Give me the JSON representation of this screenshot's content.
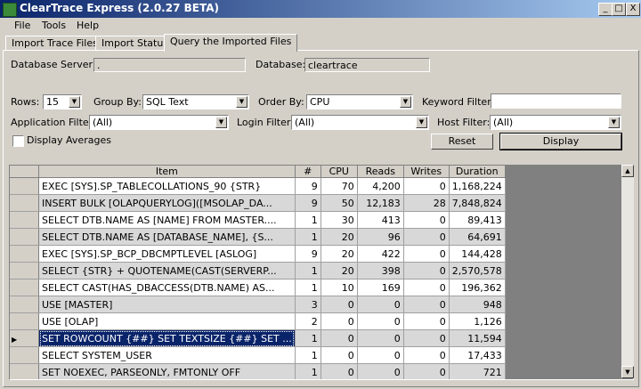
{
  "window": {
    "title": "ClearTrace Express (2.0.27 BETA)",
    "minimize": "_",
    "maximize": "□",
    "close": "X"
  },
  "menu": [
    "File",
    "Tools",
    "Help"
  ],
  "tabs": [
    {
      "label": "Import Trace Files"
    },
    {
      "label": "Import Status"
    },
    {
      "label": "Query the Imported Files"
    }
  ],
  "form": {
    "database_server_label": "Database Server:",
    "database_server_value": ".",
    "database_label": "Database:",
    "database_value": "cleartrace",
    "rows_label": "Rows:",
    "rows_value": "15",
    "group_by_label": "Group By:",
    "group_by_value": "SQL Text",
    "order_by_label": "Order By:",
    "order_by_value": "CPU",
    "keyword_filter_label": "Keyword Filter:",
    "keyword_filter_value": "",
    "application_filter_label": "Application Filter:",
    "application_filter_value": "(All)",
    "login_filter_label": "Login Filter:",
    "login_filter_value": "(All)",
    "host_filter_label": "Host Filter:",
    "host_filter_value": "(All)",
    "display_averages_label": "Display Averages",
    "reset_label": "Reset",
    "display_label": "Display"
  },
  "grid": {
    "columns": [
      "Item",
      "#",
      "CPU",
      "Reads",
      "Writes",
      "Duration"
    ],
    "rows": [
      {
        "item": "EXEC [SYS].SP_TABLECOLLATIONS_90 {STR}",
        "count": "9",
        "cpu": "70",
        "reads": "4,200",
        "writes": "0",
        "duration": "1,168,224"
      },
      {
        "item": "INSERT BULK [OLAPQUERYLOG]([MSOLAP_DA...",
        "count": "9",
        "cpu": "50",
        "reads": "12,183",
        "writes": "28",
        "duration": "7,848,824"
      },
      {
        "item": "SELECT DTB.NAME AS [NAME] FROM MASTER....",
        "count": "1",
        "cpu": "30",
        "reads": "413",
        "writes": "0",
        "duration": "89,413"
      },
      {
        "item": "SELECT DTB.NAME AS [DATABASE_NAME], {S...",
        "count": "1",
        "cpu": "20",
        "reads": "96",
        "writes": "0",
        "duration": "64,691"
      },
      {
        "item": "EXEC [SYS].SP_BCP_DBCMPTLEVEL [ASLOG]",
        "count": "9",
        "cpu": "20",
        "reads": "422",
        "writes": "0",
        "duration": "144,428"
      },
      {
        "item": "SELECT {STR} + QUOTENAME(CAST(SERVERP...",
        "count": "1",
        "cpu": "20",
        "reads": "398",
        "writes": "0",
        "duration": "2,570,578"
      },
      {
        "item": "SELECT CAST(HAS_DBACCESS(DTB.NAME) AS...",
        "count": "1",
        "cpu": "10",
        "reads": "169",
        "writes": "0",
        "duration": "196,362"
      },
      {
        "item": "USE [MASTER]",
        "count": "3",
        "cpu": "0",
        "reads": "0",
        "writes": "0",
        "duration": "948"
      },
      {
        "item": "USE [OLAP]",
        "count": "2",
        "cpu": "0",
        "reads": "0",
        "writes": "0",
        "duration": "1,126"
      },
      {
        "item": "SET ROWCOUNT {##} SET TEXTSIZE {##} SET ...",
        "count": "1",
        "cpu": "0",
        "reads": "0",
        "writes": "0",
        "duration": "11,594"
      },
      {
        "item": "SELECT SYSTEM_USER",
        "count": "1",
        "cpu": "0",
        "reads": "0",
        "writes": "0",
        "duration": "17,433"
      },
      {
        "item": "SET NOEXEC, PARSEONLY, FMTONLY OFF",
        "count": "1",
        "cpu": "0",
        "reads": "0",
        "writes": "0",
        "duration": "721"
      }
    ],
    "selected_row": 9,
    "current_row_marker": "▶"
  }
}
